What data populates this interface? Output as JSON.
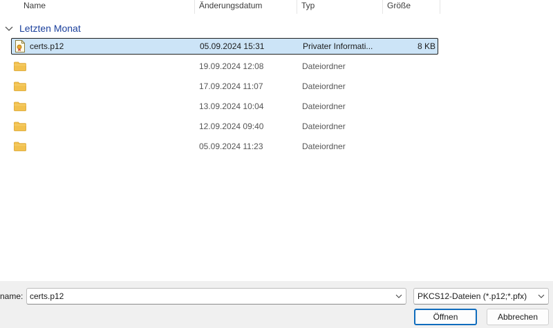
{
  "columns": {
    "name": "Name",
    "date": "Änderungsdatum",
    "type": "Typ",
    "size": "Größe"
  },
  "group": {
    "label": "Letzten Monat",
    "icon": "chevron-down-icon"
  },
  "files": [
    {
      "name": "certs.p12",
      "date": "05.09.2024 15:31",
      "type": "Privater Informati...",
      "size": "8 KB",
      "icon": "certificate-file-icon",
      "selected": true
    },
    {
      "name": "",
      "date": "19.09.2024 12:08",
      "type": "Dateiordner",
      "size": "",
      "icon": "folder-icon",
      "selected": false
    },
    {
      "name": "",
      "date": "17.09.2024 11:07",
      "type": "Dateiordner",
      "size": "",
      "icon": "folder-icon",
      "selected": false
    },
    {
      "name": "",
      "date": "13.09.2024 10:04",
      "type": "Dateiordner",
      "size": "",
      "icon": "folder-icon",
      "selected": false
    },
    {
      "name": "",
      "date": "12.09.2024 09:40",
      "type": "Dateiordner",
      "size": "",
      "icon": "folder-icon",
      "selected": false
    },
    {
      "name": "",
      "date": "05.09.2024 11:23",
      "type": "Dateiordner",
      "size": "",
      "icon": "folder-icon",
      "selected": false
    }
  ],
  "bottom": {
    "filename_label": "name:",
    "filename_value": "certs.p12",
    "filetype": "PKCS12-Dateien (*.p12;*.pfx)",
    "open_label": "Öffnen",
    "cancel_label": "Abbrechen"
  },
  "colors": {
    "accent": "#0f6cbd",
    "selection": "#cce4f7",
    "group_header": "#1a3f9c",
    "folder": "#f2c14e"
  }
}
